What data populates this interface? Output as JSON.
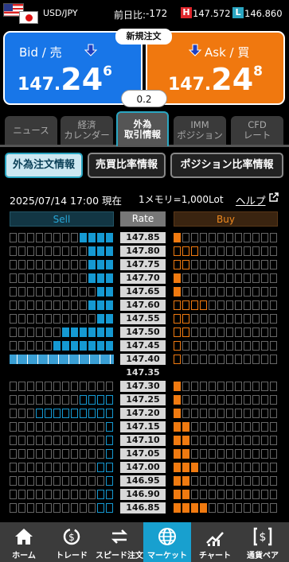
{
  "header": {
    "pair": "USD/JPY",
    "change_label": "前日比:",
    "change_value": "-172",
    "high_badge": "H",
    "high_value": "147.572",
    "low_badge": "L",
    "low_value": "146.860"
  },
  "quote": {
    "bid_label": "Bid / 売",
    "bid_price_small": "147.",
    "bid_price_big": "24",
    "bid_price_sup": "6",
    "ask_label": "Ask / 買",
    "ask_price_small": "147.",
    "ask_price_big": "24",
    "ask_price_sup": "8",
    "new_order_label": "新規注文",
    "spread": "0.2",
    "bid_color": "#1876e8",
    "ask_color": "#f0780f"
  },
  "category_tabs": [
    {
      "line1": "ニュース",
      "line2": ""
    },
    {
      "line1": "経済",
      "line2": "カレンダー"
    },
    {
      "line1": "外為",
      "line2": "取引情報"
    },
    {
      "line1": "IMM",
      "line2": "ポジション"
    },
    {
      "line1": "CFD",
      "line2": "レート"
    }
  ],
  "sub_tabs": [
    "外為注文情報",
    "売買比率情報",
    "ポジション比率情報"
  ],
  "info": {
    "datetime": "2025/07/14 17:00 現在",
    "unit": "1メモリ=1,000Lot",
    "help": "ヘルプ"
  },
  "book": {
    "sell_header": "Sell",
    "rate_header": "Rate",
    "buy_header": "Buy",
    "mid_rate": "147.35",
    "upper_rows": [
      {
        "rate": "147.85",
        "sell": 4,
        "buy": 1,
        "buy_out": 0
      },
      {
        "rate": "147.80",
        "sell": 3,
        "buy": 0,
        "buy_out": 3
      },
      {
        "rate": "147.75",
        "sell": 3,
        "buy": 0,
        "buy_out": 2
      },
      {
        "rate": "147.70",
        "sell": 3,
        "buy": 1,
        "buy_out": 0
      },
      {
        "rate": "147.65",
        "sell": 2,
        "buy": 1,
        "buy_out": 0
      },
      {
        "rate": "147.60",
        "sell": 3,
        "buy": 0,
        "buy_out": 4
      },
      {
        "rate": "147.55",
        "sell": 2,
        "buy": 0,
        "buy_out": 2
      },
      {
        "rate": "147.50",
        "sell": 6,
        "buy": 0,
        "buy_out": 2
      },
      {
        "rate": "147.45",
        "sell": 7,
        "buy": 0,
        "buy_out": 1
      },
      {
        "rate": "147.40",
        "sell": 12,
        "buy": 0,
        "buy_out": 1
      }
    ],
    "lower_rows": [
      {
        "rate": "147.30",
        "sell_out": 0,
        "buy": 1
      },
      {
        "rate": "147.25",
        "sell_out": 4,
        "buy": 1
      },
      {
        "rate": "147.20",
        "sell_out": 9,
        "buy": 1
      },
      {
        "rate": "147.15",
        "sell_out": 1,
        "buy": 2
      },
      {
        "rate": "147.10",
        "sell_out": 1,
        "buy": 2
      },
      {
        "rate": "147.05",
        "sell_out": 1,
        "buy": 2
      },
      {
        "rate": "147.00",
        "sell_out": 2,
        "buy": 3
      },
      {
        "rate": "146.95",
        "sell_out": 1,
        "buy": 2
      },
      {
        "rate": "146.90",
        "sell_out": 2,
        "buy": 2
      },
      {
        "rate": "146.85",
        "sell_out": 2,
        "buy": 4
      }
    ]
  },
  "nav": [
    {
      "label": "ホーム",
      "icon": "home-icon"
    },
    {
      "label": "トレード",
      "icon": "trade-icon"
    },
    {
      "label": "スピード注文",
      "icon": "speed-order-icon"
    },
    {
      "label": "マーケット",
      "icon": "globe-icon"
    },
    {
      "label": "チャート",
      "icon": "chart-icon"
    },
    {
      "label": "通貨ペア",
      "icon": "currency-pair-icon"
    }
  ],
  "colors": {
    "sell": "#1599d2",
    "buy": "#f07a10",
    "accent": "#18a0cf"
  }
}
